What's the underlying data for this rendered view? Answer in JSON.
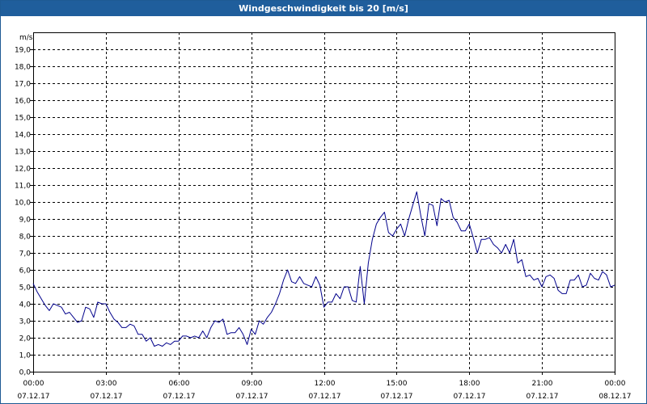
{
  "window": {
    "title": "Windgeschwindigkeit bis 20 [m/s]"
  },
  "chart_data": {
    "type": "line",
    "title": "Windgeschwindigkeit bis 20 [m/s]",
    "xlabel": "",
    "ylabel": "m/s",
    "ylim": [
      0,
      20
    ],
    "y_ticks": [
      "0,0",
      "1,0",
      "2,0",
      "3,0",
      "4,0",
      "5,0",
      "6,0",
      "7,0",
      "8,0",
      "9,0",
      "10,0",
      "11,0",
      "12,0",
      "13,0",
      "14,0",
      "15,0",
      "16,0",
      "17,0",
      "18,0",
      "19,0"
    ],
    "x_ticks": [
      {
        "time": "00:00",
        "date": "07.12.17"
      },
      {
        "time": "03:00",
        "date": "07.12.17"
      },
      {
        "time": "06:00",
        "date": "07.12.17"
      },
      {
        "time": "09:00",
        "date": "07.12.17"
      },
      {
        "time": "12:00",
        "date": "07.12.17"
      },
      {
        "time": "15:00",
        "date": "07.12.17"
      },
      {
        "time": "18:00",
        "date": "07.12.17"
      },
      {
        "time": "21:00",
        "date": "07.12.17"
      },
      {
        "time": "00:00",
        "date": "08.12.17"
      }
    ],
    "grid": true,
    "line_color": "#00008b",
    "series": [
      {
        "name": "",
        "points": [
          [
            "07.12.17 00:00",
            5.2
          ],
          [
            "07.12.17 00:10",
            4.7
          ],
          [
            "07.12.17 00:20",
            4.3
          ],
          [
            "07.12.17 00:30",
            3.9
          ],
          [
            "07.12.17 00:40",
            3.6
          ],
          [
            "07.12.17 00:50",
            4.0
          ],
          [
            "07.12.17 01:00",
            3.9
          ],
          [
            "07.12.17 01:10",
            3.8
          ],
          [
            "07.12.17 01:20",
            3.4
          ],
          [
            "07.12.17 01:30",
            3.5
          ],
          [
            "07.12.17 01:40",
            3.2
          ],
          [
            "07.12.17 01:50",
            2.9
          ],
          [
            "07.12.17 02:00",
            3.0
          ],
          [
            "07.12.17 02:10",
            3.8
          ],
          [
            "07.12.17 02:20",
            3.7
          ],
          [
            "07.12.17 02:30",
            3.2
          ],
          [
            "07.12.17 02:40",
            4.1
          ],
          [
            "07.12.17 02:50",
            4.0
          ],
          [
            "07.12.17 03:00",
            4.0
          ],
          [
            "07.12.17 03:10",
            3.5
          ],
          [
            "07.12.17 03:20",
            3.1
          ],
          [
            "07.12.17 03:30",
            2.9
          ],
          [
            "07.12.17 03:40",
            2.6
          ],
          [
            "07.12.17 03:50",
            2.6
          ],
          [
            "07.12.17 04:00",
            2.8
          ],
          [
            "07.12.17 04:10",
            2.7
          ],
          [
            "07.12.17 04:20",
            2.2
          ],
          [
            "07.12.17 04:30",
            2.2
          ],
          [
            "07.12.17 04:40",
            1.8
          ],
          [
            "07.12.17 04:50",
            2.0
          ],
          [
            "07.12.17 05:00",
            1.5
          ],
          [
            "07.12.17 05:10",
            1.6
          ],
          [
            "07.12.17 05:20",
            1.5
          ],
          [
            "07.12.17 05:30",
            1.7
          ],
          [
            "07.12.17 05:40",
            1.6
          ],
          [
            "07.12.17 05:50",
            1.8
          ],
          [
            "07.12.17 06:00",
            1.8
          ],
          [
            "07.12.17 06:10",
            2.1
          ],
          [
            "07.12.17 06:20",
            2.1
          ],
          [
            "07.12.17 06:30",
            2.0
          ],
          [
            "07.12.17 06:40",
            2.1
          ],
          [
            "07.12.17 06:50",
            2.0
          ],
          [
            "07.12.17 07:00",
            2.4
          ],
          [
            "07.12.17 07:10",
            2.0
          ],
          [
            "07.12.17 07:20",
            2.6
          ],
          [
            "07.12.17 07:30",
            3.0
          ],
          [
            "07.12.17 07:40",
            2.9
          ],
          [
            "07.12.17 07:50",
            3.1
          ],
          [
            "07.12.17 08:00",
            2.2
          ],
          [
            "07.12.17 08:10",
            2.3
          ],
          [
            "07.12.17 08:20",
            2.3
          ],
          [
            "07.12.17 08:30",
            2.6
          ],
          [
            "07.12.17 08:40",
            2.2
          ],
          [
            "07.12.17 08:50",
            1.6
          ],
          [
            "07.12.17 09:00",
            2.5
          ],
          [
            "07.12.17 09:10",
            2.2
          ],
          [
            "07.12.17 09:20",
            3.0
          ],
          [
            "07.12.17 09:30",
            2.8
          ],
          [
            "07.12.17 09:40",
            3.2
          ],
          [
            "07.12.17 09:50",
            3.5
          ],
          [
            "07.12.17 10:00",
            4.0
          ],
          [
            "07.12.17 10:10",
            4.6
          ],
          [
            "07.12.17 10:20",
            5.4
          ],
          [
            "07.12.17 10:30",
            6.0
          ],
          [
            "07.12.17 10:40",
            5.3
          ],
          [
            "07.12.17 10:50",
            5.2
          ],
          [
            "07.12.17 11:00",
            5.6
          ],
          [
            "07.12.17 11:10",
            5.2
          ],
          [
            "07.12.17 11:20",
            5.1
          ],
          [
            "07.12.17 11:30",
            5.0
          ],
          [
            "07.12.17 11:40",
            5.6
          ],
          [
            "07.12.17 11:50",
            5.1
          ],
          [
            "07.12.17 12:00",
            3.8
          ],
          [
            "07.12.17 12:10",
            4.1
          ],
          [
            "07.12.17 12:20",
            4.1
          ],
          [
            "07.12.17 12:30",
            4.6
          ],
          [
            "07.12.17 12:40",
            4.3
          ],
          [
            "07.12.17 12:50",
            5.0
          ],
          [
            "07.12.17 13:00",
            5.0
          ],
          [
            "07.12.17 13:10",
            4.2
          ],
          [
            "07.12.17 13:20",
            4.1
          ],
          [
            "07.12.17 13:30",
            6.2
          ],
          [
            "07.12.17 13:40",
            4.0
          ],
          [
            "07.12.17 13:50",
            6.4
          ],
          [
            "07.12.17 14:00",
            7.8
          ],
          [
            "07.12.17 14:10",
            8.7
          ],
          [
            "07.12.17 14:20",
            9.1
          ],
          [
            "07.12.17 14:30",
            9.4
          ],
          [
            "07.12.17 14:40",
            8.2
          ],
          [
            "07.12.17 14:50",
            8.0
          ],
          [
            "07.12.17 15:00",
            8.4
          ],
          [
            "07.12.17 15:10",
            8.7
          ],
          [
            "07.12.17 15:20",
            8.0
          ],
          [
            "07.12.17 15:30",
            9.0
          ],
          [
            "07.12.17 15:40",
            9.8
          ],
          [
            "07.12.17 15:50",
            10.6
          ],
          [
            "07.12.17 16:00",
            9.2
          ],
          [
            "07.12.17 16:10",
            8.0
          ],
          [
            "07.12.17 16:20",
            9.9
          ],
          [
            "07.12.17 16:30",
            9.8
          ],
          [
            "07.12.17 16:40",
            8.6
          ],
          [
            "07.12.17 16:50",
            10.2
          ],
          [
            "07.12.17 17:00",
            10.0
          ],
          [
            "07.12.17 17:10",
            10.1
          ],
          [
            "07.12.17 17:20",
            9.1
          ],
          [
            "07.12.17 17:30",
            8.8
          ],
          [
            "07.12.17 17:40",
            8.3
          ],
          [
            "07.12.17 17:50",
            8.3
          ],
          [
            "07.12.17 18:00",
            8.7
          ],
          [
            "07.12.17 18:10",
            7.9
          ],
          [
            "07.12.17 18:20",
            7.0
          ],
          [
            "07.12.17 18:30",
            7.8
          ],
          [
            "07.12.17 18:40",
            7.8
          ],
          [
            "07.12.17 18:50",
            7.9
          ],
          [
            "07.12.17 19:00",
            7.5
          ],
          [
            "07.12.17 19:10",
            7.3
          ],
          [
            "07.12.17 19:20",
            7.0
          ],
          [
            "07.12.17 19:30",
            7.5
          ],
          [
            "07.12.17 19:40",
            7.0
          ],
          [
            "07.12.17 19:50",
            7.8
          ],
          [
            "07.12.17 20:00",
            6.4
          ],
          [
            "07.12.17 20:10",
            6.6
          ],
          [
            "07.12.17 20:20",
            5.6
          ],
          [
            "07.12.17 20:30",
            5.7
          ],
          [
            "07.12.17 20:40",
            5.4
          ],
          [
            "07.12.17 20:50",
            5.5
          ],
          [
            "07.12.17 21:00",
            5.0
          ],
          [
            "07.12.17 21:10",
            5.6
          ],
          [
            "07.12.17 21:20",
            5.7
          ],
          [
            "07.12.17 21:30",
            5.5
          ],
          [
            "07.12.17 21:40",
            4.8
          ],
          [
            "07.12.17 21:50",
            4.6
          ],
          [
            "07.12.17 22:00",
            4.6
          ],
          [
            "07.12.17 22:10",
            5.4
          ],
          [
            "07.12.17 22:20",
            5.4
          ],
          [
            "07.12.17 22:30",
            5.7
          ],
          [
            "07.12.17 22:40",
            5.0
          ],
          [
            "07.12.17 22:50",
            5.1
          ],
          [
            "07.12.17 23:00",
            5.8
          ],
          [
            "07.12.17 23:10",
            5.5
          ],
          [
            "07.12.17 23:20",
            5.4
          ],
          [
            "07.12.17 23:30",
            5.9
          ],
          [
            "07.12.17 23:40",
            5.7
          ],
          [
            "07.12.17 23:50",
            5.0
          ],
          [
            "08.12.17 00:00",
            5.1
          ]
        ]
      }
    ]
  }
}
